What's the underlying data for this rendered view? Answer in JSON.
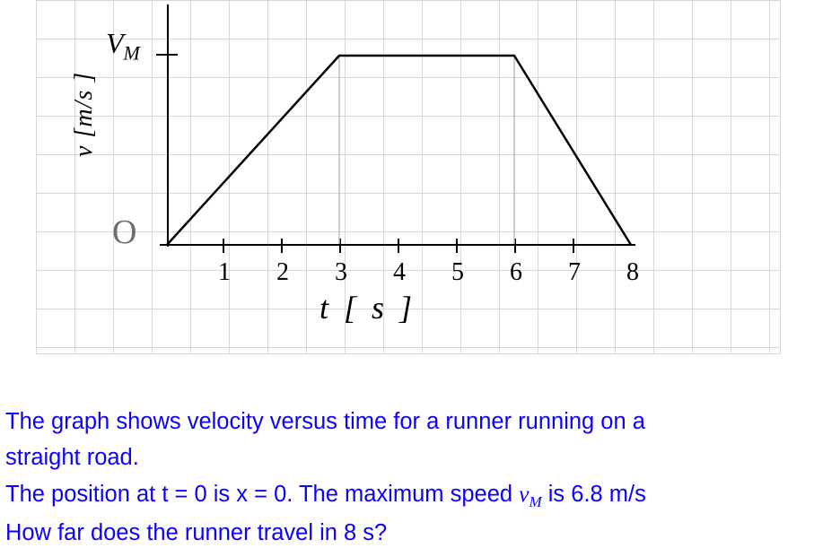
{
  "chart_data": {
    "type": "line",
    "title": "",
    "xlabel": "t  [ s ]",
    "ylabel": "v [m/s ]",
    "x": [
      0,
      3,
      6,
      8
    ],
    "y": [
      0,
      6.8,
      6.8,
      0
    ],
    "xlim": [
      0,
      8
    ],
    "ylim": [
      0,
      6.8
    ],
    "x_ticks": [
      1,
      2,
      3,
      4,
      5,
      6,
      7,
      8
    ],
    "y_tick_labels": [
      "V_M"
    ],
    "origin_label": "O",
    "v_max": 6.8,
    "droplines_x": [
      3,
      6
    ]
  },
  "question": {
    "line1": "The graph shows velocity versus time for a runner running on a",
    "line2": "straight road.",
    "line3a": "The position at t = 0 is x = 0. The maximum speed ",
    "vm_symbol_v": "v",
    "vm_symbol_m": "M",
    "line3b": " is 6.8 m/s",
    "line4": "How far does the runner travel in 8 s?"
  },
  "labels": {
    "vm_v": "V",
    "vm_m": "M",
    "origin": "O"
  }
}
